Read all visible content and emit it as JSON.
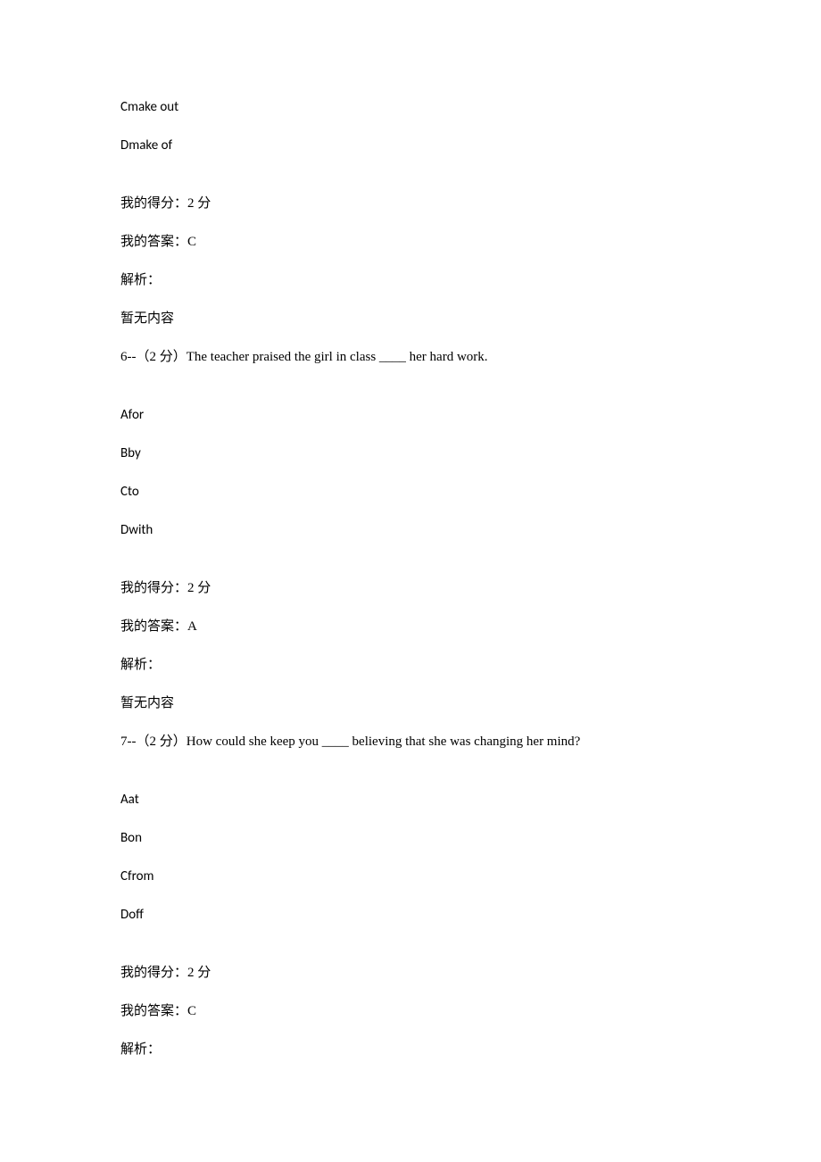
{
  "q5_tail": {
    "opt_c": "Cmake out",
    "opt_d": "Dmake of",
    "score_label": "我的得分：2 分",
    "answer_label": "我的答案：C",
    "analysis_label": "解析：",
    "analysis_body": "暂无内容"
  },
  "q6": {
    "prompt": "6--（2 分）The teacher praised the girl in class ____ her hard work.",
    "opt_a": "Afor",
    "opt_b": "Bby",
    "opt_c": "Cto",
    "opt_d": "Dwith",
    "score_label": "我的得分：2 分",
    "answer_label": "我的答案：A",
    "analysis_label": "解析：",
    "analysis_body": "暂无内容"
  },
  "q7": {
    "prompt": "7--（2 分）How could she keep you ____ believing that she was changing her mind?",
    "opt_a": "Aat",
    "opt_b": "Bon",
    "opt_c": "Cfrom",
    "opt_d": "Doff",
    "score_label": "我的得分：2 分",
    "answer_label": "我的答案：C",
    "analysis_label": "解析："
  }
}
